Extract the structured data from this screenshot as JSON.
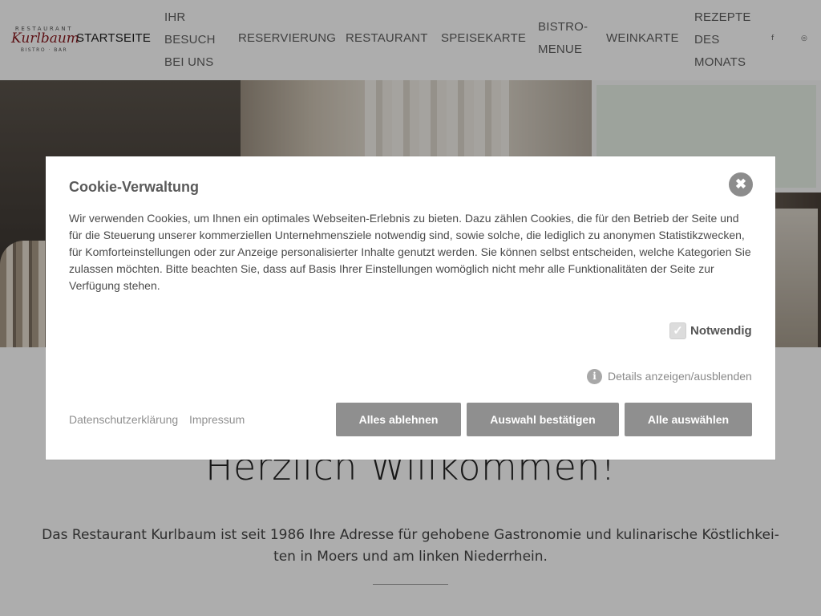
{
  "header": {
    "logo": {
      "top": "RESTAURANT",
      "name": "Kurlbaum",
      "bottom": "BISTRO · BAR"
    },
    "nav": [
      {
        "lines": [
          "STARTSEITE"
        ]
      },
      {
        "lines": [
          "IHR",
          "BESUCH",
          "BEI UNS"
        ]
      },
      {
        "lines": [
          "RESERVIERUNG"
        ]
      },
      {
        "lines": [
          "RESTAURANT"
        ]
      },
      {
        "lines": [
          "SPEISEKARTE"
        ]
      },
      {
        "lines": [
          "BISTRO-",
          "MENUE"
        ]
      },
      {
        "lines": [
          "WEINKARTE"
        ]
      },
      {
        "lines": [
          "REZEPTE",
          "DES",
          "MONATS"
        ]
      }
    ],
    "social": {
      "facebook": "f",
      "instagram": "◎"
    }
  },
  "main": {
    "welcome": "Herzlich Willkommen!",
    "intro": "Das Restaurant Kurlbaum ist seit 1986 Ihre Adresse für gehobene Gastronomie und kulinarische Köstlichkei-ten in Moers und am linken Niederrhein."
  },
  "cookie": {
    "title": "Cookie-Verwaltung",
    "close_glyph": "✖",
    "text": "Wir verwenden Cookies, um Ihnen ein optimales Webseiten-Erlebnis zu bieten. Dazu zählen Cookies, die für den Betrieb der Seite und für die Steuerung unserer kommerziellen Unternehmensziele notwendig sind, sowie solche, die lediglich zu anonymen Statistikzwecken, für Komforteinstellungen oder zur Anzeige personalisierter Inhalte genutzt werden. Sie können selbst entscheiden, welche Kategorien Sie zulassen möchten. Bitte beachten Sie, dass auf Basis Ihrer Einstellungen womöglich nicht mehr alle Funktionalitäten der Seite zur Verfügung stehen.",
    "necessary_label": "Notwendig",
    "necessary_checked": true,
    "check_glyph": "✓",
    "info_glyph": "i",
    "details_label": "Details anzeigen/ausblenden",
    "privacy_link": "Datenschutzerklärung",
    "imprint_link": "Impressum",
    "reject_all": "Alles ablehnen",
    "confirm_selection": "Auswahl bestätigen",
    "select_all": "Alle auswählen"
  },
  "colors": {
    "button": "#8f8f8f",
    "overlay": "rgba(0,0,0,0.32)",
    "logo_red": "#8a1a1f"
  }
}
